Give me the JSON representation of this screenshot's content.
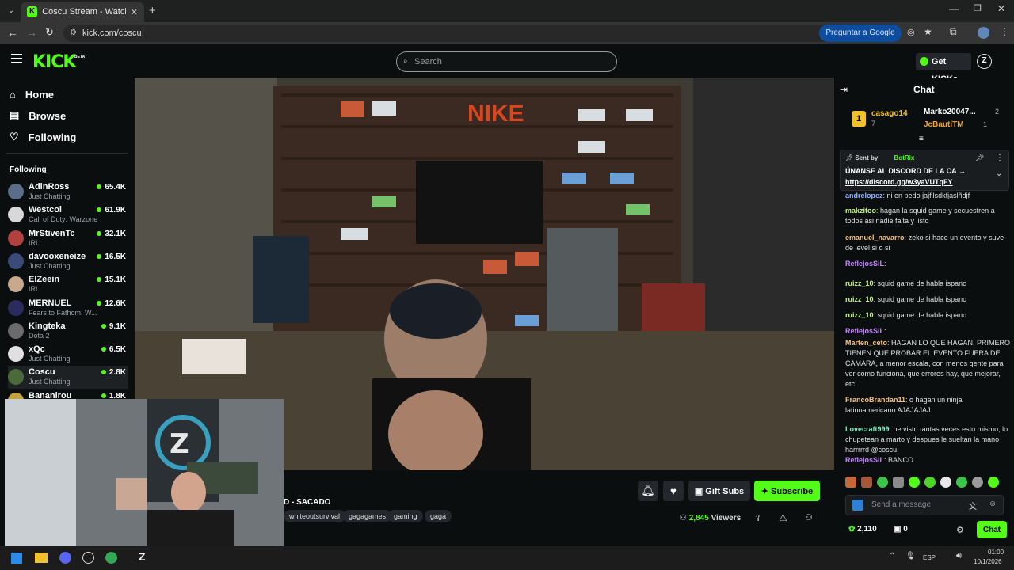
{
  "browser": {
    "tab_title": "Coscu Stream - Watch Live on K",
    "url": "kick.com/coscu",
    "google_button": "Preguntar a Google"
  },
  "header": {
    "logo": "KICK",
    "logo_badge": "BETA",
    "search_placeholder": "Search",
    "get_kicks": "Get KICKs"
  },
  "nav": {
    "home": "Home",
    "browse": "Browse",
    "following": "Following",
    "following_section": "Following"
  },
  "following": [
    {
      "name": "AdinRoss",
      "category": "Just Chatting",
      "viewers": "65.4K",
      "color": "#5a6e8c"
    },
    {
      "name": "Westcol",
      "category": "Call of Duty: Warzone",
      "viewers": "61.9K",
      "color": "#d8d8d8"
    },
    {
      "name": "MrStivenTc",
      "category": "IRL",
      "viewers": "32.1K",
      "color": "#b0413e"
    },
    {
      "name": "davooxeneize",
      "category": "Just Chatting",
      "viewers": "16.5K",
      "color": "#3a4b7a"
    },
    {
      "name": "ElZeein",
      "category": "IRL",
      "viewers": "15.1K",
      "color": "#c9a98e"
    },
    {
      "name": "MERNUEL",
      "category": "Fears to Fathom: W...",
      "viewers": "12.6K",
      "color": "#2b2b5e"
    },
    {
      "name": "Kingteka",
      "category": "Dota 2",
      "viewers": "9.1K",
      "color": "#6b6b6b"
    },
    {
      "name": "xQc",
      "category": "Just Chatting",
      "viewers": "6.5K",
      "color": "#e0e0e0"
    },
    {
      "name": "Coscu",
      "category": "Just Chatting",
      "viewers": "2.8K",
      "color": "#4a6a3a"
    },
    {
      "name": "Bananirou",
      "category": "",
      "viewers": "1.8K",
      "color": "#c6a33a"
    }
  ],
  "stream": {
    "title_fragment": "D - SACADO",
    "tags": [
      "whiteoutsurvival",
      "gagagames",
      "gaming",
      "gagá"
    ],
    "viewers": "2,845",
    "viewers_label": "Viewers",
    "gift_subs": "Gift Subs",
    "subscribe": "Subscribe"
  },
  "chat": {
    "title": "Chat",
    "leaderboard": {
      "first": {
        "rank": "1",
        "name": "casago14",
        "count": "7"
      },
      "second": {
        "name": "Marko20047...",
        "count": "2"
      },
      "third": {
        "name": "JcBautiTM",
        "count": "1"
      }
    },
    "pinned": {
      "sent_by": "Sent by",
      "bot": "BotRix",
      "text": "ÚNANSE AL DISCORD DE LA CA →",
      "link": "https://discord.gg/w3yaVUTqFY"
    },
    "messages": [
      {
        "user": "andrelopez",
        "color": "#8fb3ff",
        "text": "ni en pedo jajfilsdkfjaslñdjf"
      },
      {
        "user": "makzitoo",
        "color": "#c7f27a",
        "text": "hagan la squid game y secuestren a todos asi nadie falta y listo"
      },
      {
        "user": "emanuel_navarro",
        "color": "#f2c27a",
        "text": "zeko si hace un evento y suve de level si o si"
      },
      {
        "user": "ReflejosSiL",
        "color": "#c689ff",
        "text": ""
      },
      {
        "user": "ruizz_10",
        "color": "#c7f27a",
        "text": "squid game de habla ispano"
      },
      {
        "user": "ruizz_10",
        "color": "#c7f27a",
        "text": "squid game de habla ispano"
      },
      {
        "user": "ruizz_10",
        "color": "#c7f27a",
        "text": "squid game de habla ispano"
      },
      {
        "user": "ReflejosSiL",
        "color": "#c689ff",
        "text": ""
      },
      {
        "user": "Marten_ceto",
        "color": "#f2c27a",
        "text": "HAGAN LO QUE HAGAN, PRIMERO TIENEN QUE PROBAR EL EVENTO FUERA DE CAMARA, a menor escala, con menos gente para ver como funciona, que errores hay, que mejorar, etc."
      },
      {
        "user": "FrancoBrandan11",
        "color": "#f2c27a",
        "text": "o hagan un ninja latinoamericano AJAJAJAJ"
      },
      {
        "user": "Lovecraft999",
        "color": "#7ff2c3",
        "text": "he visto tantas veces esto mismo, lo chupetean a marto y despues le sueltan la mano harrrrrd @coscu"
      },
      {
        "user": "ReflejosSiL",
        "color": "#c689ff",
        "text": "BANCO"
      }
    ],
    "input_placeholder": "Send a message",
    "points": "2,110",
    "gift_count": "0",
    "send_button": "Chat"
  },
  "taskbar": {
    "lang": "ESP",
    "time": "01:00",
    "date": "10/1/2026"
  },
  "colors": {
    "brand": "#53fc18",
    "background": "#0b0e0f",
    "panel": "#24272c"
  }
}
